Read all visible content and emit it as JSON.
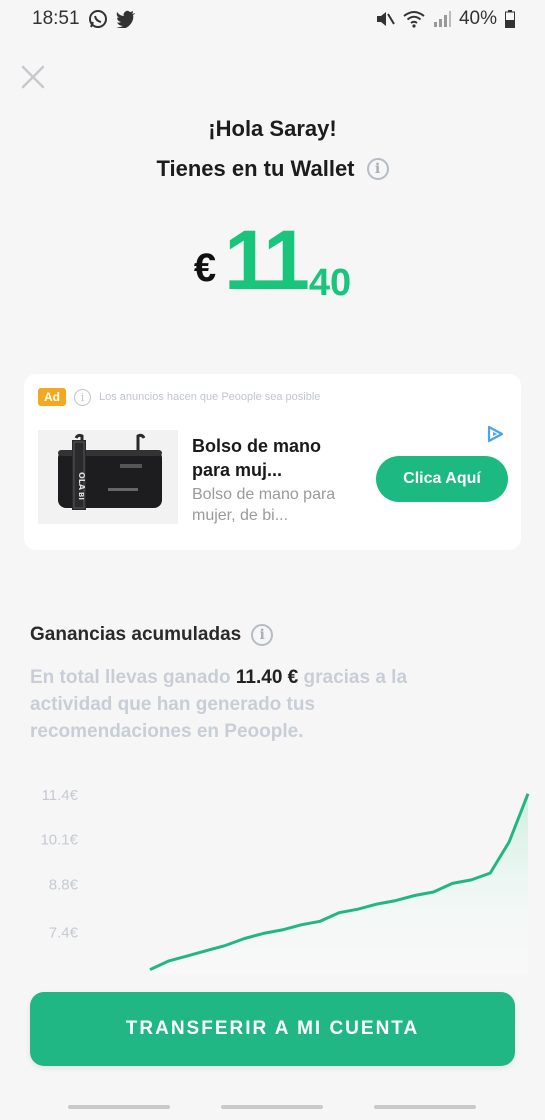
{
  "status_bar": {
    "time": "18:51",
    "battery": "40%"
  },
  "header": {
    "greeting": "¡Hola Saray!",
    "wallet_label": "Tienes en tu Wallet"
  },
  "balance": {
    "currency": "€",
    "integer": "11",
    "decimal": "40"
  },
  "ad": {
    "badge": "Ad",
    "disclaimer": "Los anuncios hacen que Peoople sea posible",
    "title": "Bolso de mano para muj...",
    "description": "Bolso de mano para mujer, de bi...",
    "cta": "Clica Aquí"
  },
  "earnings": {
    "title": "Ganancias acumuladas",
    "desc_before": "En total llevas ganado ",
    "amount": "11.40 €",
    "desc_after": " gracias a la actividad que han generado tus recomendaciones en Peoople."
  },
  "chart_data": {
    "type": "area",
    "ytick_labels": [
      "11.4€",
      "10.1€",
      "8.8€",
      "7.4€"
    ],
    "yticks": [
      11.4,
      10.1,
      8.8,
      7.4
    ],
    "ylim": [
      6.2,
      11.8
    ],
    "x": [
      0,
      1,
      2,
      3,
      4,
      5,
      6,
      7,
      8,
      9,
      10,
      11,
      12,
      13,
      14,
      15,
      16,
      17,
      18,
      19,
      20
    ],
    "values": [
      6.3,
      6.55,
      6.7,
      6.85,
      7.0,
      7.2,
      7.35,
      7.45,
      7.6,
      7.7,
      7.95,
      8.05,
      8.2,
      8.3,
      8.45,
      8.55,
      8.8,
      8.9,
      9.1,
      10.0,
      11.4
    ],
    "color": "#21b784",
    "fill_color": "#cfeee0"
  },
  "transfer_button": {
    "label": "TRANSFERIR A MI CUENTA"
  },
  "colors": {
    "accent": "#19c47b",
    "button": "#21b784",
    "ad_badge": "#f3a820"
  }
}
